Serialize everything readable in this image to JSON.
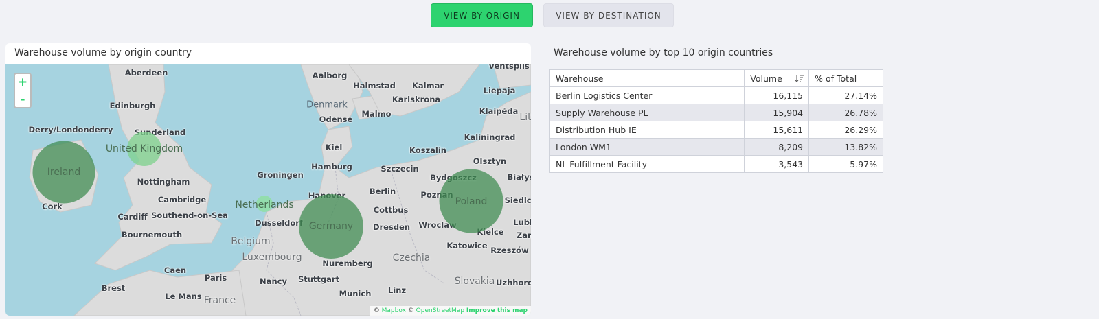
{
  "toggle": {
    "origin_label": "VIEW BY ORIGIN",
    "destination_label": "VIEW BY DESTINATION"
  },
  "map_panel": {
    "title": "Warehouse volume by origin country",
    "zoom_in": "+",
    "zoom_out": "-",
    "attribution": {
      "copyright": "©",
      "mapbox": "Mapbox",
      "copyright2": "©",
      "osm": "OpenStreetMap",
      "improve": "Improve this map"
    },
    "bubbles": [
      {
        "country": "Ireland",
        "color": "#3d8a4f",
        "volume": 15611
      },
      {
        "country": "United Kingdom",
        "color": "#7ed18c",
        "volume": 8209
      },
      {
        "country": "Netherlands",
        "color": "#8fe0a0",
        "volume": 3543
      },
      {
        "country": "Germany",
        "color": "#3d8a4f",
        "volume": 16115
      },
      {
        "country": "Poland",
        "color": "#3d8a4f",
        "volume": 15904
      }
    ],
    "place_labels": [
      "Aberdeen",
      "Edinburgh",
      "Derry/Londonderry",
      "Sunderland",
      "Nottingham",
      "Cambridge",
      "Cardiff",
      "Southend-on-Sea",
      "Bournemouth",
      "Cork",
      "Aalborg",
      "Halmstad",
      "Kalmar",
      "Ventspils",
      "Liepaja",
      "Klaipėda",
      "Kaliningrad",
      "Karlskrona",
      "Malmo",
      "Odense",
      "Denmark",
      "Kiel",
      "Koszalin",
      "Olsztyn",
      "Hamburg",
      "Szczecin",
      "Groningen",
      "Hanover",
      "Berlin",
      "Bydgoszcz",
      "Białys",
      "Poznan",
      "Siedlce",
      "Cottbus",
      "Dusseldorf",
      "Belgium",
      "Dresden",
      "Wroclaw",
      "Kielce",
      "Lubli",
      "Zam",
      "Luxembourg",
      "Katowice",
      "Rzeszów",
      "Nuremberg",
      "Czechia",
      "Caen",
      "Paris",
      "Nancy",
      "Stuttgart",
      "Slovakia",
      "Uzhhoro",
      "Brest",
      "Le Mans",
      "France",
      "Munich",
      "Linz",
      "Lit"
    ]
  },
  "table_panel": {
    "title": "Warehouse volume by top 10 origin countries",
    "headers": {
      "warehouse": "Warehouse",
      "volume": "Volume",
      "pct": "% of Total"
    },
    "rows": [
      {
        "warehouse": "Berlin Logistics Center",
        "volume": "16,115",
        "pct": "27.14%"
      },
      {
        "warehouse": "Supply Warehouse PL",
        "volume": "15,904",
        "pct": "26.78%"
      },
      {
        "warehouse": "Distribution Hub IE",
        "volume": "15,611",
        "pct": "26.29%"
      },
      {
        "warehouse": "London WM1",
        "volume": "8,209",
        "pct": "13.82%"
      },
      {
        "warehouse": "NL Fulfillment Facility",
        "volume": "3,543",
        "pct": "5.97%"
      }
    ]
  }
}
